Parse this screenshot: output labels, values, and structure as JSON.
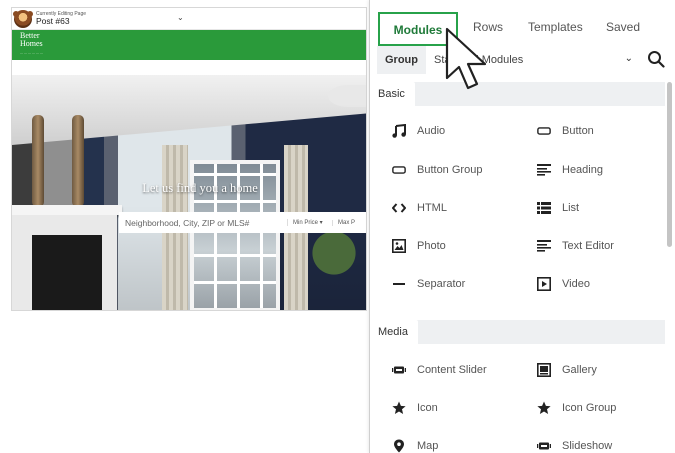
{
  "editbar": {
    "small_label": "Currently Editing Page",
    "post_title": "Post #63"
  },
  "site": {
    "logo_line1": "Better",
    "logo_line2": "Homes",
    "hero_title": "Let us find you a home",
    "search_placeholder": "Neighborhood, City, ZIP or MLS#",
    "min_price": "Min Price",
    "max_price": "Max P"
  },
  "panel": {
    "tabs": [
      {
        "label": "Modules",
        "active": true
      },
      {
        "label": "Rows"
      },
      {
        "label": "Templates"
      },
      {
        "label": "Saved"
      }
    ],
    "filter": {
      "label": "Group",
      "select_value": "Standard Modules"
    },
    "accent_color": "#27a24a",
    "groups": [
      {
        "name": "Basic",
        "items": [
          {
            "label": "Audio",
            "icon": "music-note-icon"
          },
          {
            "label": "Button",
            "icon": "button-icon"
          },
          {
            "label": "Button Group",
            "icon": "button-group-icon"
          },
          {
            "label": "Heading",
            "icon": "heading-icon"
          },
          {
            "label": "HTML",
            "icon": "code-icon"
          },
          {
            "label": "List",
            "icon": "list-icon"
          },
          {
            "label": "Photo",
            "icon": "photo-icon"
          },
          {
            "label": "Text Editor",
            "icon": "text-editor-icon"
          },
          {
            "label": "Separator",
            "icon": "separator-icon"
          },
          {
            "label": "Video",
            "icon": "video-icon"
          }
        ]
      },
      {
        "name": "Media",
        "items": [
          {
            "label": "Content Slider",
            "icon": "content-slider-icon"
          },
          {
            "label": "Gallery",
            "icon": "gallery-icon"
          },
          {
            "label": "Icon",
            "icon": "star-icon"
          },
          {
            "label": "Icon Group",
            "icon": "star-icon"
          },
          {
            "label": "Map",
            "icon": "map-pin-icon"
          },
          {
            "label": "Slideshow",
            "icon": "slideshow-icon"
          }
        ]
      }
    ]
  }
}
